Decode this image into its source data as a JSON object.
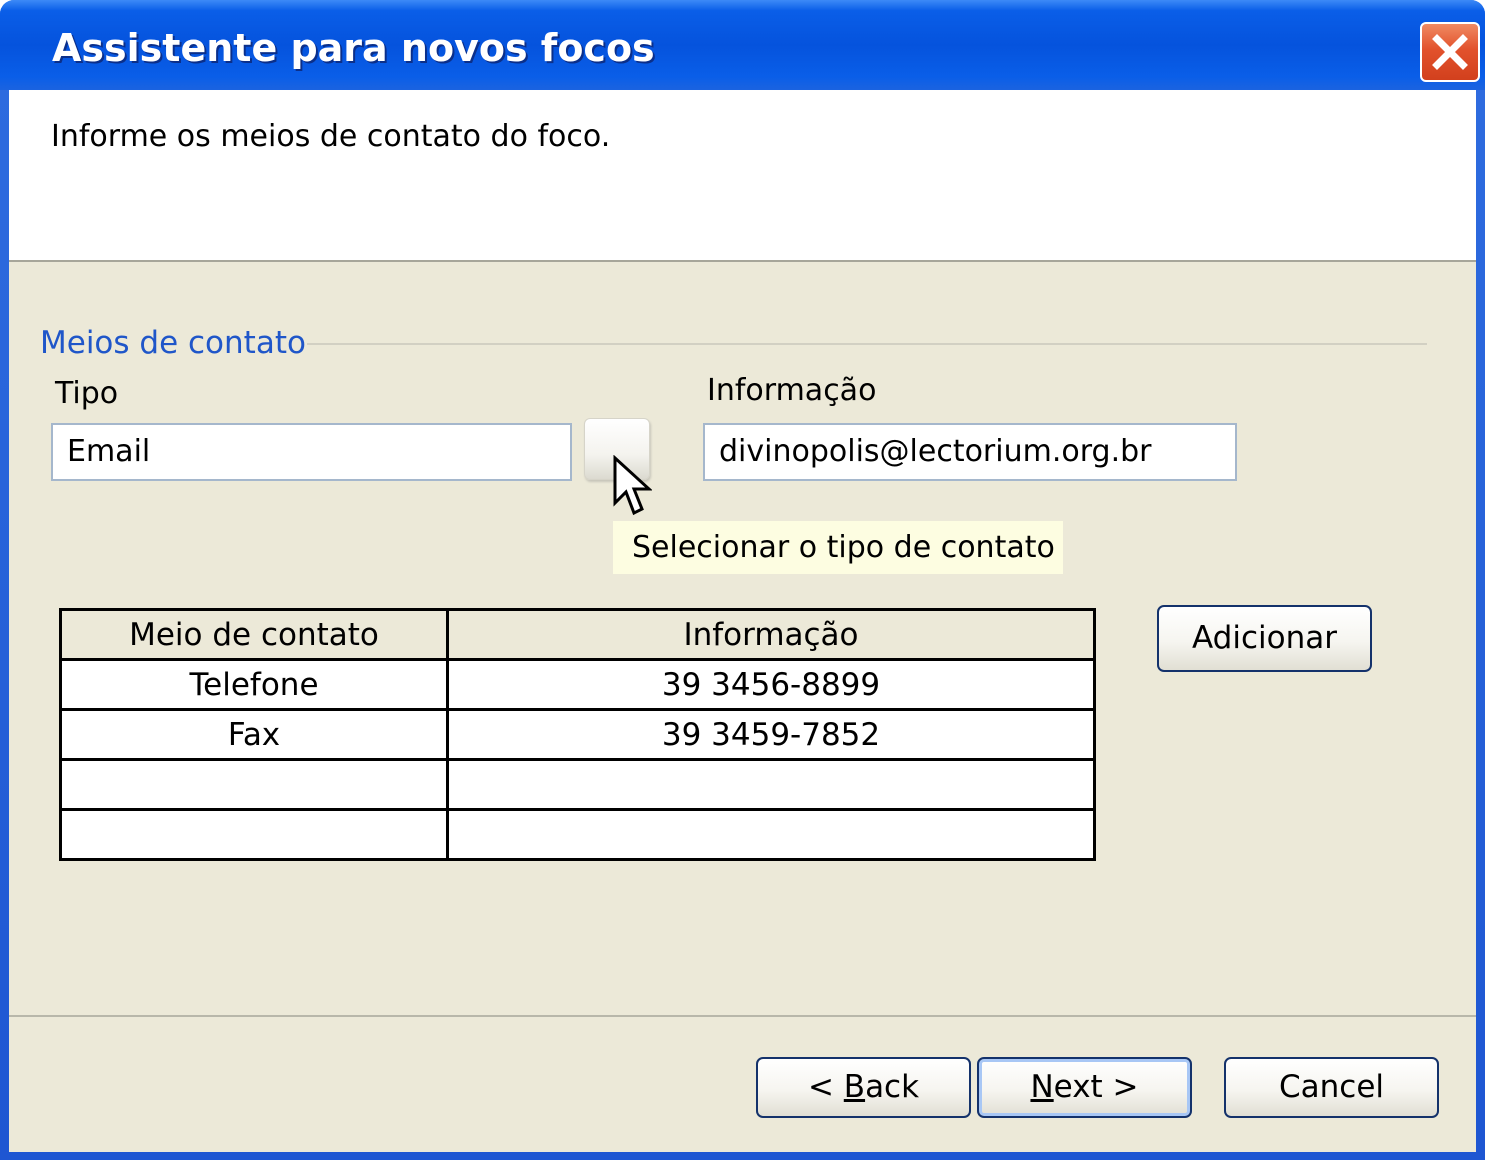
{
  "window": {
    "title": "Assistente para novos focos"
  },
  "header": {
    "instruction": "Informe os meios de contato do foco."
  },
  "group": {
    "label": "Meios de contato"
  },
  "form": {
    "tipo_label": "Tipo",
    "tipo_value": "Email",
    "informacao_label": "Informação",
    "informacao_value": "divinopolis@lectorium.org.br",
    "tooltip": "Selecionar o tipo de contato"
  },
  "table": {
    "headers": [
      "Meio de contato",
      "Informação"
    ],
    "rows": [
      [
        "Telefone",
        "39 3456-8899"
      ],
      [
        "Fax",
        "39 3459-7852"
      ],
      [
        "",
        ""
      ],
      [
        "",
        ""
      ]
    ]
  },
  "buttons": {
    "add": "Adicionar",
    "back_prefix": "< ",
    "back_mnemonic": "B",
    "back_rest": "ack",
    "next_mnemonic": "N",
    "next_rest": "ext >",
    "cancel": "Cancel"
  },
  "colors": {
    "titlebar": "#0553dd",
    "client_bg": "#ece9d8",
    "group_label": "#1f56c9",
    "tooltip_bg": "#fdfde1",
    "close_button": "#e2522c"
  },
  "icons": {
    "close": "close-x-icon",
    "cursor": "mouse-pointer-icon"
  }
}
